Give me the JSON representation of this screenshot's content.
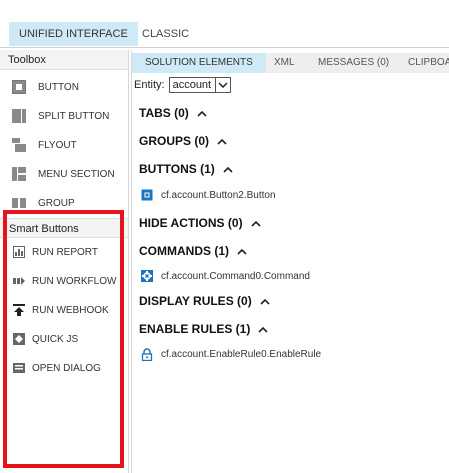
{
  "top_tabs": [
    {
      "label": "UNIFIED INTERFACE",
      "active": true
    },
    {
      "label": "CLASSIC",
      "active": false
    }
  ],
  "toolbox": {
    "title": "Toolbox",
    "items": [
      {
        "label": "BUTTON",
        "icon": "button-icon"
      },
      {
        "label": "SPLIT BUTTON",
        "icon": "split-button-icon"
      },
      {
        "label": "FLYOUT",
        "icon": "flyout-icon"
      },
      {
        "label": "MENU SECTION",
        "icon": "menu-section-icon"
      },
      {
        "label": "GROUP",
        "icon": "group-icon"
      }
    ]
  },
  "smart_buttons": {
    "title": "Smart Buttons",
    "items": [
      {
        "label": "RUN REPORT",
        "icon": "report-icon"
      },
      {
        "label": "RUN WORKFLOW",
        "icon": "workflow-icon"
      },
      {
        "label": "RUN WEBHOOK",
        "icon": "webhook-icon"
      },
      {
        "label": "QUICK JS",
        "icon": "quick-js-icon"
      },
      {
        "label": "OPEN DIALOG",
        "icon": "dialog-icon"
      }
    ],
    "highlight_color": "#e8121b"
  },
  "right_tabs": [
    {
      "label": "SOLUTION ELEMENTS",
      "active": true
    },
    {
      "label": "XML",
      "active": false
    },
    {
      "label": "MESSAGES (0)",
      "active": false
    },
    {
      "label": "CLIPBOARD",
      "active": false
    }
  ],
  "entity": {
    "label": "Entity:",
    "value": "account"
  },
  "sections": [
    {
      "title": "TABS (0)",
      "entries": []
    },
    {
      "title": "GROUPS (0)",
      "entries": []
    },
    {
      "title": "BUTTONS (1)",
      "entries": [
        {
          "label": "cf.account.Button2.Button",
          "icon": "button-item-icon"
        }
      ]
    },
    {
      "title": "HIDE ACTIONS (0)",
      "entries": []
    },
    {
      "title": "COMMANDS (1)",
      "entries": [
        {
          "label": "cf.account.Command0.Command",
          "icon": "command-icon"
        }
      ]
    },
    {
      "title": "DISPLAY RULES (0)",
      "entries": []
    },
    {
      "title": "ENABLE RULES (1)",
      "entries": [
        {
          "label": "cf.account.EnableRule0.EnableRule",
          "icon": "lock-icon"
        }
      ]
    }
  ],
  "colors": {
    "accent": "#cfe9f7",
    "icon_blue": "#1e73be",
    "icon_gray": "#666666"
  }
}
